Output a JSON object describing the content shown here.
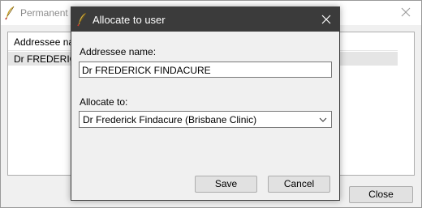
{
  "background_window": {
    "title": "Permanent a",
    "list_header": "Addressee nam",
    "list_row": "Dr FREDERICK",
    "close_label": "Close"
  },
  "dialog": {
    "title": "Allocate to user",
    "addressee_label": "Addressee name:",
    "addressee_value": "Dr FREDERICK FINDACURE",
    "allocate_label": "Allocate to:",
    "allocate_selected": "Dr Frederick  Findacure (Brisbane Clinic)",
    "save_label": "Save",
    "cancel_label": "Cancel"
  },
  "icons": {
    "app_icon": "feather-quill-icon",
    "close_icon": "close-icon",
    "dropdown_icon": "chevron-down-icon"
  },
  "colors": {
    "dialog_titlebar": "#3b3b3b",
    "window_background": "#f0f0f0",
    "button_face": "#e1e1e1",
    "selected_row": "#e5e5e5"
  }
}
